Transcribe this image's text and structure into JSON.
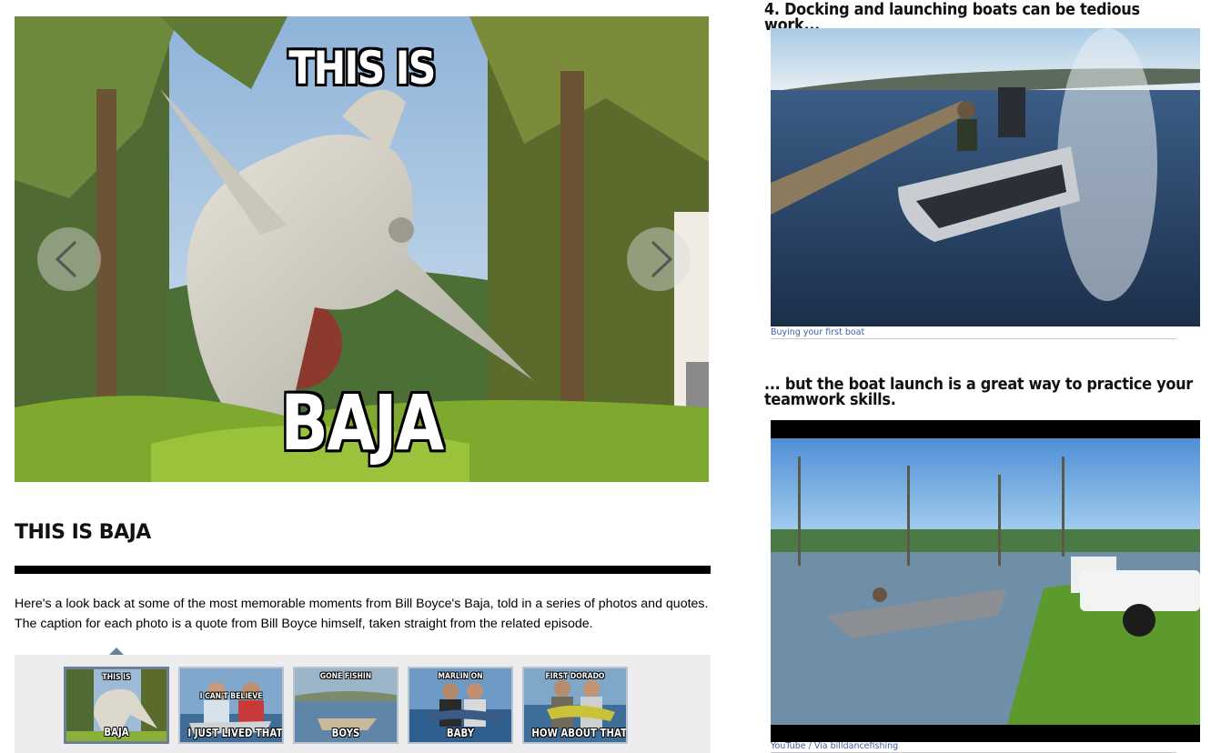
{
  "slideshow": {
    "meme_top": "THIS IS",
    "meme_bottom": "BAJA",
    "title": "THIS IS BAJA",
    "description": "Here's a look back at some of the most memorable moments from Bill Boyce's Baja, told in a series of photos and quotes. The caption for each photo is a quote from Bill Boyce himself, taken straight from the related episode.",
    "prev_icon": "chevron-left-icon",
    "next_icon": "chevron-right-icon",
    "thumbnails": [
      {
        "top": "THIS IS",
        "bottom": "BAJA",
        "active": true
      },
      {
        "top": "I CAN'T BELIEVE",
        "bottom": "I JUST LIVED THAT",
        "active": false
      },
      {
        "top": "GONE FISHIN",
        "bottom": "BOYS",
        "active": false
      },
      {
        "top": "MARLIN ON",
        "bottom": "BABY",
        "active": false
      },
      {
        "top": "FIRST DORADO",
        "bottom": "HOW ABOUT THAT",
        "active": false
      }
    ]
  },
  "article": {
    "heading_1": "4. Docking and launching boats can be tedious work...",
    "credit_1": "Buying your first boat",
    "heading_2": "...  but the boat launch is a great way to practice your teamwork skills.",
    "credit_2": "YouTube / Via billdancefishing"
  },
  "colors": {
    "title_rule": "#000000",
    "thumb_strip_bg": "#ececec",
    "credit_link": "#3d5fa8"
  }
}
